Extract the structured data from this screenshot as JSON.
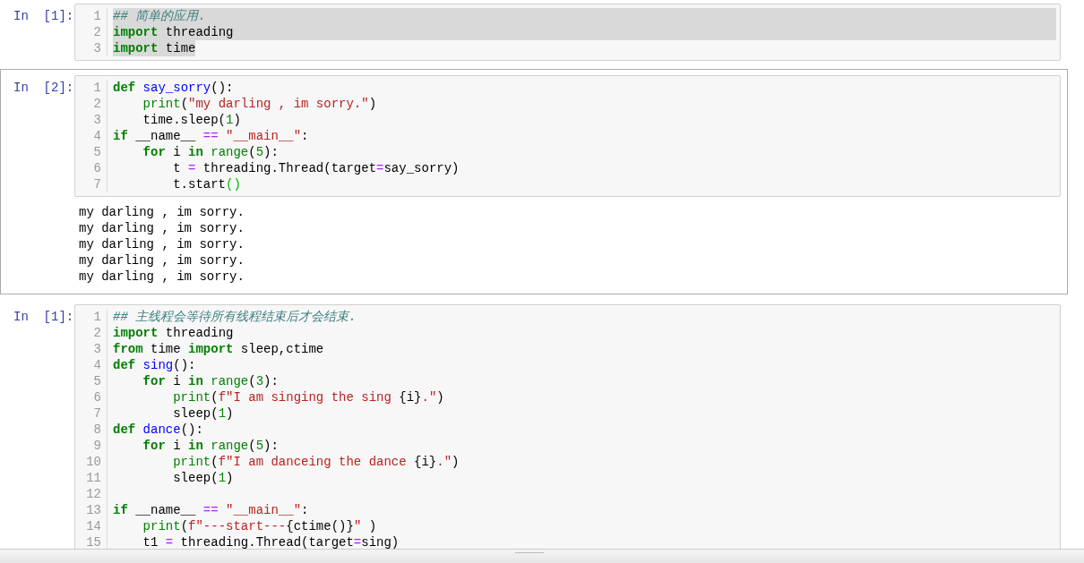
{
  "cells": [
    {
      "prompt": "In  [1]:",
      "active": false,
      "lines": [
        {
          "number": "1",
          "selected": true,
          "tokens": [
            {
              "kind": "cm",
              "text": "## 简单的应用."
            }
          ]
        },
        {
          "number": "2",
          "selected": true,
          "tokens": [
            {
              "kind": "kw",
              "text": "import"
            },
            {
              "kind": "txt",
              "text": " threading"
            }
          ]
        },
        {
          "number": "3",
          "selected": true,
          "tokens": [
            {
              "kind": "kw",
              "text": "import"
            },
            {
              "kind": "txt",
              "text": " time"
            }
          ]
        }
      ]
    },
    {
      "prompt": "In  [2]:",
      "active": true,
      "lines": [
        {
          "number": "1",
          "tokens": [
            {
              "kind": "kw",
              "text": "def"
            },
            {
              "kind": "def",
              "text": " say_sorry"
            },
            {
              "kind": "txt",
              "text": "():"
            }
          ]
        },
        {
          "number": "2",
          "tokens": [
            {
              "kind": "bi",
              "text": "    print"
            },
            {
              "kind": "txt",
              "text": "("
            },
            {
              "kind": "str",
              "text": "\"my darling , im sorry.\""
            },
            {
              "kind": "txt",
              "text": ")"
            }
          ]
        },
        {
          "number": "3",
          "tokens": [
            {
              "kind": "txt",
              "text": "    time.sleep("
            },
            {
              "kind": "num",
              "text": "1"
            },
            {
              "kind": "txt",
              "text": ")"
            }
          ]
        },
        {
          "number": "4",
          "tokens": [
            {
              "kind": "kw",
              "text": "if"
            },
            {
              "kind": "txt",
              "text": " __name__ "
            },
            {
              "kind": "op",
              "text": "=="
            },
            {
              "kind": "str",
              "text": " \"__main__\""
            },
            {
              "kind": "txt",
              "text": ":"
            }
          ]
        },
        {
          "number": "5",
          "tokens": [
            {
              "kind": "kw",
              "text": "    for"
            },
            {
              "kind": "txt",
              "text": " i "
            },
            {
              "kind": "kw",
              "text": "in"
            },
            {
              "kind": "bi",
              "text": " range"
            },
            {
              "kind": "txt",
              "text": "("
            },
            {
              "kind": "num",
              "text": "5"
            },
            {
              "kind": "txt",
              "text": "):"
            }
          ]
        },
        {
          "number": "6",
          "tokens": [
            {
              "kind": "txt",
              "text": "        t "
            },
            {
              "kind": "op",
              "text": "="
            },
            {
              "kind": "txt",
              "text": " threading.Thread(target"
            },
            {
              "kind": "op",
              "text": "="
            },
            {
              "kind": "txt",
              "text": "say_sorry)"
            }
          ]
        },
        {
          "number": "7",
          "tokens": [
            {
              "kind": "txt",
              "text": "        t.start"
            },
            {
              "kind": "match",
              "text": "()"
            }
          ]
        }
      ],
      "output": [
        "my darling , im sorry.",
        "my darling , im sorry.",
        "my darling , im sorry.",
        "my darling , im sorry.",
        "my darling , im sorry."
      ]
    },
    {
      "prompt": "In  [1]:",
      "active": false,
      "lines": [
        {
          "number": "1",
          "tokens": [
            {
              "kind": "cm",
              "text": "## 主线程会等待所有线程结束后才会结束."
            }
          ]
        },
        {
          "number": "2",
          "tokens": [
            {
              "kind": "kw",
              "text": "import"
            },
            {
              "kind": "txt",
              "text": " threading"
            }
          ]
        },
        {
          "number": "3",
          "tokens": [
            {
              "kind": "kw",
              "text": "from"
            },
            {
              "kind": "txt",
              "text": " time "
            },
            {
              "kind": "kw",
              "text": "import"
            },
            {
              "kind": "txt",
              "text": " sleep,ctime"
            }
          ]
        },
        {
          "number": "4",
          "tokens": [
            {
              "kind": "kw",
              "text": "def"
            },
            {
              "kind": "def",
              "text": " sing"
            },
            {
              "kind": "txt",
              "text": "():"
            }
          ]
        },
        {
          "number": "5",
          "tokens": [
            {
              "kind": "kw",
              "text": "    for"
            },
            {
              "kind": "txt",
              "text": " i "
            },
            {
              "kind": "kw",
              "text": "in"
            },
            {
              "kind": "bi",
              "text": " range"
            },
            {
              "kind": "txt",
              "text": "("
            },
            {
              "kind": "num",
              "text": "3"
            },
            {
              "kind": "txt",
              "text": "):"
            }
          ]
        },
        {
          "number": "6",
          "tokens": [
            {
              "kind": "bi",
              "text": "        print"
            },
            {
              "kind": "txt",
              "text": "("
            },
            {
              "kind": "str",
              "text": "f\"I am singing the sing "
            },
            {
              "kind": "txt",
              "text": "{i}"
            },
            {
              "kind": "str",
              "text": ".\""
            },
            {
              "kind": "txt",
              "text": ")"
            }
          ]
        },
        {
          "number": "7",
          "tokens": [
            {
              "kind": "txt",
              "text": "        sleep("
            },
            {
              "kind": "num",
              "text": "1"
            },
            {
              "kind": "txt",
              "text": ")"
            }
          ]
        },
        {
          "number": "8",
          "tokens": [
            {
              "kind": "kw",
              "text": "def"
            },
            {
              "kind": "def",
              "text": " dance"
            },
            {
              "kind": "txt",
              "text": "():"
            }
          ]
        },
        {
          "number": "9",
          "tokens": [
            {
              "kind": "kw",
              "text": "    for"
            },
            {
              "kind": "txt",
              "text": " i "
            },
            {
              "kind": "kw",
              "text": "in"
            },
            {
              "kind": "bi",
              "text": " range"
            },
            {
              "kind": "txt",
              "text": "("
            },
            {
              "kind": "num",
              "text": "5"
            },
            {
              "kind": "txt",
              "text": "):"
            }
          ]
        },
        {
          "number": "10",
          "tokens": [
            {
              "kind": "bi",
              "text": "        print"
            },
            {
              "kind": "txt",
              "text": "("
            },
            {
              "kind": "str",
              "text": "f\"I am danceing the dance "
            },
            {
              "kind": "txt",
              "text": "{i}"
            },
            {
              "kind": "str",
              "text": ".\""
            },
            {
              "kind": "txt",
              "text": ")"
            }
          ]
        },
        {
          "number": "11",
          "tokens": [
            {
              "kind": "txt",
              "text": "        sleep("
            },
            {
              "kind": "num",
              "text": "1"
            },
            {
              "kind": "txt",
              "text": ")"
            }
          ]
        },
        {
          "number": "12"
        },
        {
          "number": "13",
          "tokens": [
            {
              "kind": "kw",
              "text": "if"
            },
            {
              "kind": "txt",
              "text": " __name__ "
            },
            {
              "kind": "op",
              "text": "=="
            },
            {
              "kind": "str",
              "text": " \"__main__\""
            },
            {
              "kind": "txt",
              "text": ":"
            }
          ]
        },
        {
          "number": "14",
          "tokens": [
            {
              "kind": "bi",
              "text": "    print"
            },
            {
              "kind": "txt",
              "text": "("
            },
            {
              "kind": "str",
              "text": "f\"---start---"
            },
            {
              "kind": "txt",
              "text": "{ctime()}"
            },
            {
              "kind": "str",
              "text": "\""
            },
            {
              "kind": "txt",
              "text": " )"
            }
          ]
        },
        {
          "number": "15",
          "tokens": [
            {
              "kind": "txt",
              "text": "    t1 "
            },
            {
              "kind": "op",
              "text": "="
            },
            {
              "kind": "txt",
              "text": " threading.Thread(target"
            },
            {
              "kind": "op",
              "text": "="
            },
            {
              "kind": "txt",
              "text": "sing)"
            }
          ]
        }
      ]
    }
  ]
}
